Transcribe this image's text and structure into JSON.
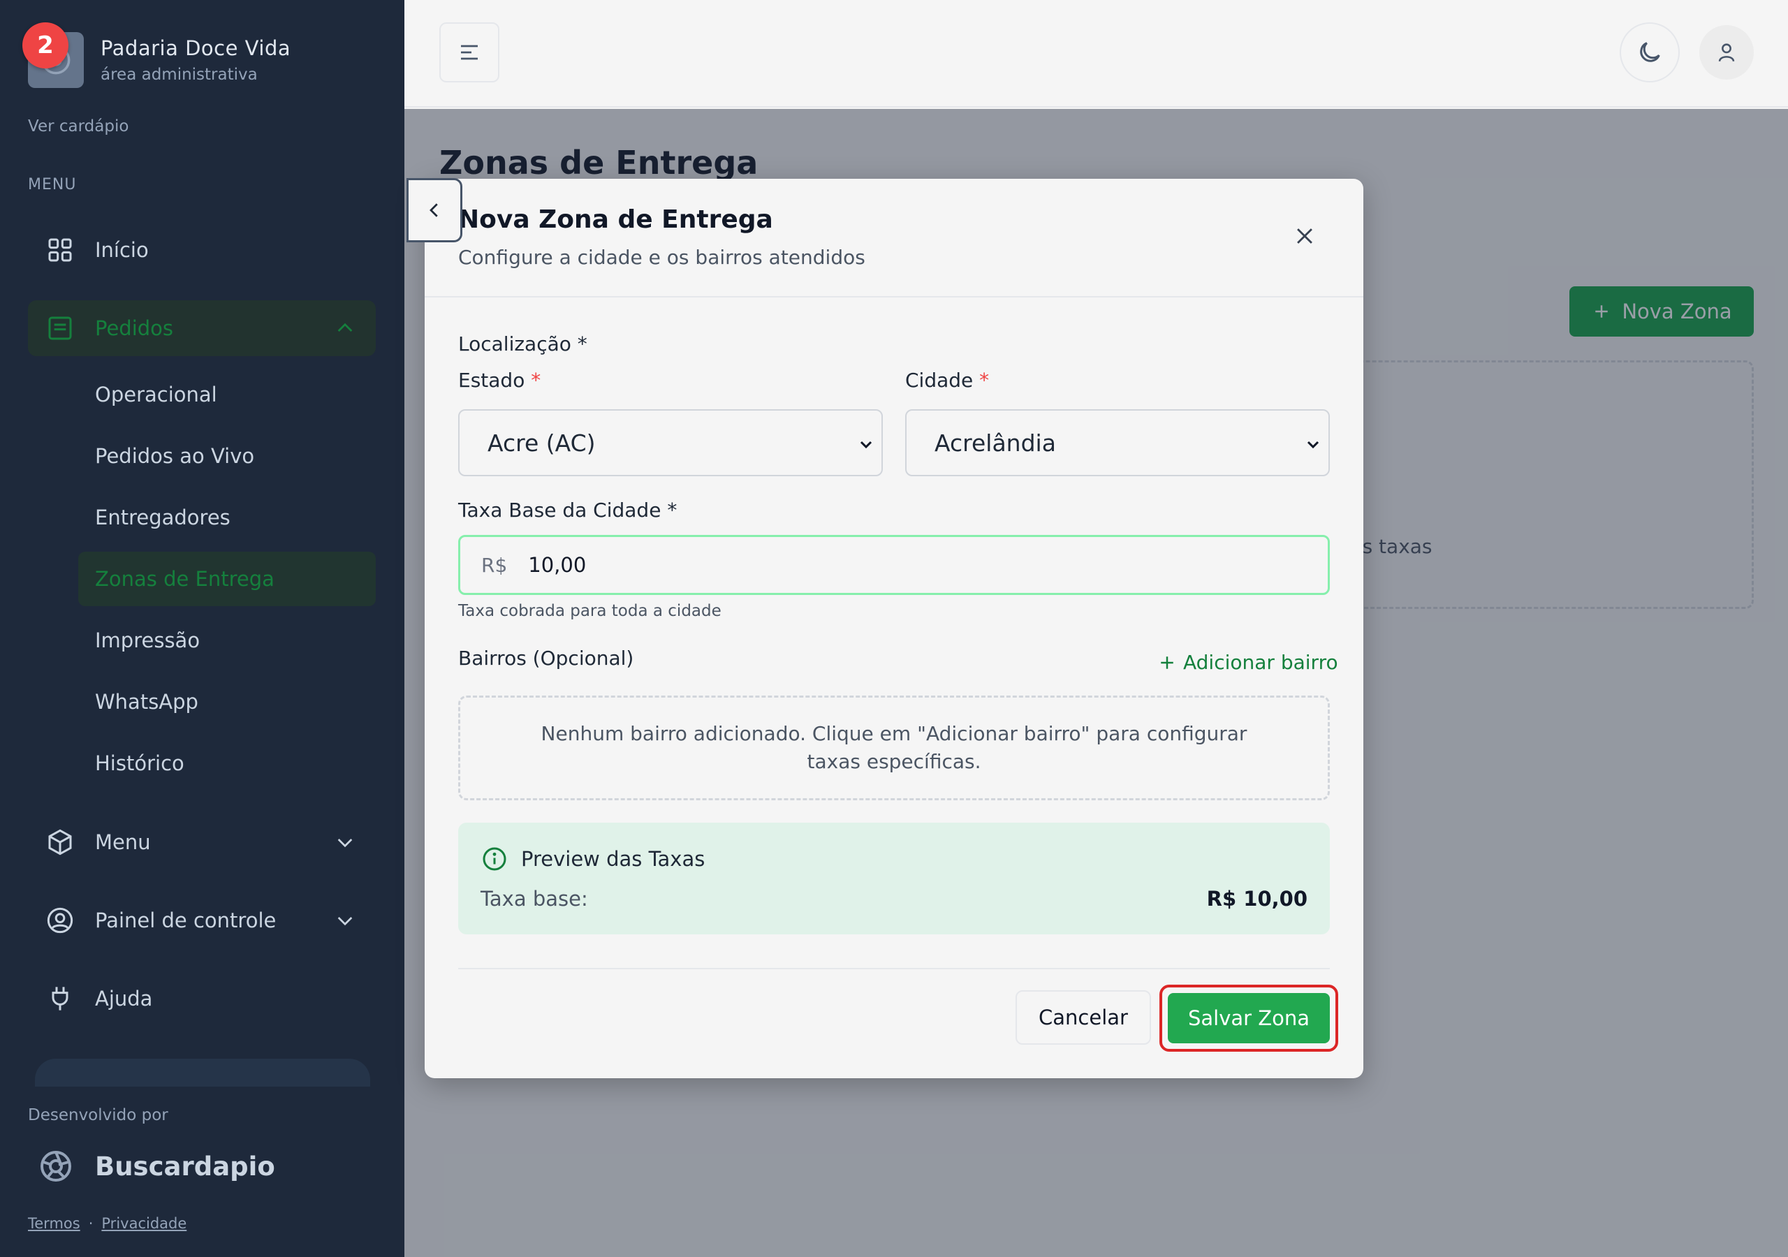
{
  "sidebar": {
    "brand_name": "Padaria Doce Vida",
    "brand_subtitle": "área administrativa",
    "notification_count": "2",
    "view_menu_link": "Ver cardápio",
    "menu_heading": "MENU",
    "items": {
      "inicio": "Início",
      "pedidos": "Pedidos",
      "menu": "Menu",
      "painel": "Painel de controle",
      "ajuda": "Ajuda"
    },
    "pedidos_sub": {
      "operacional": "Operacional",
      "ao_vivo": "Pedidos ao Vivo",
      "entregadores": "Entregadores",
      "zonas": "Zonas de Entrega",
      "impressao": "Impressão",
      "whatsapp": "WhatsApp",
      "historico": "Histórico"
    },
    "developed_by": "Desenvolvido por",
    "developer_name": "Buscardapio",
    "terms_link": "Termos",
    "separator": "·",
    "privacy_link": "Privacidade"
  },
  "main": {
    "page_title": "Zonas de Entrega",
    "new_zone_button": "Nova Zona",
    "empty_text_fragment": "r as taxas"
  },
  "modal": {
    "title": "Nova Zona de Entrega",
    "subtitle": "Configure a cidade e os bairros atendidos",
    "location_label": "Localização *",
    "state_label": "Estado",
    "state_value": "Acre (AC)",
    "city_label": "Cidade",
    "city_value": "Acrelândia",
    "required_mark": "*",
    "base_fee_label": "Taxa Base da Cidade *",
    "currency_prefix": "R$",
    "base_fee_value": "10,00",
    "base_fee_hint": "Taxa cobrada para toda a cidade",
    "neighborhoods_label": "Bairros (Opcional)",
    "add_neighborhood": "Adicionar bairro",
    "neighborhoods_empty": "Nenhum bairro adicionado. Clique em \"Adicionar bairro\" para configurar taxas específicas.",
    "preview_title": "Preview das Taxas",
    "preview_base_label": "Taxa base:",
    "preview_base_value": "R$ 10,00",
    "cancel_button": "Cancelar",
    "save_button": "Salvar Zona"
  },
  "colors": {
    "sidebar_bg": "#1e293b",
    "accent_green": "#16a34a",
    "badge_red": "#ef4444",
    "highlight_ring": "#dc2626"
  }
}
